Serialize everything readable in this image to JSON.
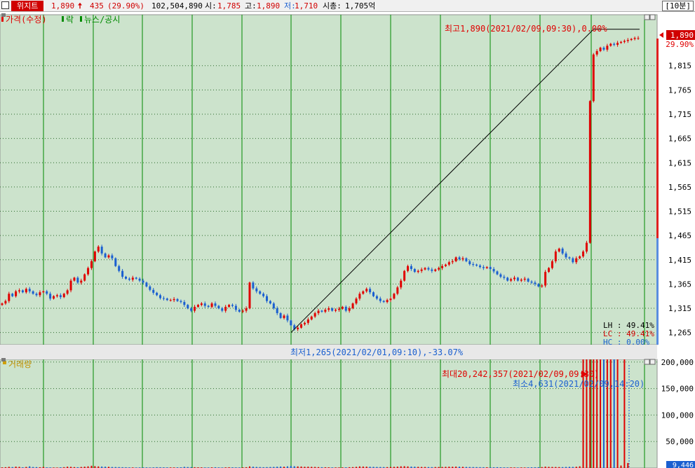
{
  "header": {
    "stock_name": "위지트",
    "price": "1,890",
    "change": "435",
    "change_pct": "(29.90%)",
    "volume": "102,504,890",
    "open_label": "시:",
    "open": "1,785",
    "high_label": "고:",
    "high": "1,890",
    "low_label": "저:",
    "low": "1,710",
    "mcap_label": "시총:",
    "mcap": "1,705억",
    "period": "[10분]"
  },
  "legend": {
    "price_panel": [
      "가격(수정)",
      "락",
      "뉴스/공시"
    ],
    "volume_panel": "거래량"
  },
  "annotations": {
    "max_price": "최고1,890(2021/02/09,09:30),0.00%",
    "min_price": "최저1,265(2021/02/01,09:10),-33.07%",
    "max_volume": "최대20,242,357(2021/02/09,09:30)",
    "min_volume": "최소4,631(2021/02/09,14:20)"
  },
  "stats": [
    {
      "label": "LH",
      "value": "49.41%",
      "color": "#000000"
    },
    {
      "label": "LC",
      "value": "49.41%",
      "color": "#d00000"
    },
    {
      "label": "HC",
      "value": "0.00%",
      "color": "#1a5fd0"
    }
  ],
  "current_price_label": {
    "price": "1,890",
    "pct": "29.90%"
  },
  "volume_last_label": "9,446",
  "colors": {
    "up": "#e00000",
    "down": "#1a5fd0",
    "bg": "#cce3cc",
    "gridline": "#008a00",
    "axis_text": "#000000"
  },
  "chart_data": [
    {
      "type": "candlestick",
      "title": "가격(수정)",
      "ylim": [
        1240,
        1920
      ],
      "yticks": [
        1265,
        1315,
        1365,
        1415,
        1465,
        1515,
        1565,
        1615,
        1665,
        1715,
        1765,
        1815
      ],
      "ytick_labels": [
        "1,265",
        "1,315",
        "1,365",
        "1,415",
        "1,465",
        "1,515",
        "1,565",
        "1,615",
        "1,665",
        "1,715",
        "1,765",
        "1,815"
      ],
      "close": [
        1325,
        1330,
        1345,
        1340,
        1350,
        1352,
        1348,
        1355,
        1350,
        1345,
        1342,
        1348,
        1350,
        1345,
        1335,
        1340,
        1342,
        1338,
        1345,
        1352,
        1372,
        1378,
        1368,
        1372,
        1385,
        1398,
        1412,
        1432,
        1442,
        1428,
        1420,
        1424,
        1418,
        1402,
        1392,
        1380,
        1376,
        1374,
        1378,
        1376,
        1372,
        1368,
        1360,
        1353,
        1347,
        1342,
        1336,
        1335,
        1332,
        1332,
        1334,
        1330,
        1328,
        1322,
        1315,
        1310,
        1318,
        1322,
        1325,
        1320,
        1318,
        1325,
        1320,
        1315,
        1310,
        1318,
        1322,
        1320,
        1312,
        1308,
        1310,
        1315,
        1368,
        1356,
        1350,
        1345,
        1340,
        1330,
        1325,
        1315,
        1305,
        1295,
        1300,
        1290,
        1280,
        1272,
        1275,
        1282,
        1285,
        1292,
        1298,
        1305,
        1310,
        1308,
        1312,
        1315,
        1310,
        1312,
        1314,
        1318,
        1310,
        1315,
        1325,
        1335,
        1345,
        1350,
        1355,
        1348,
        1340,
        1335,
        1330,
        1328,
        1332,
        1335,
        1345,
        1358,
        1372,
        1392,
        1402,
        1396,
        1390,
        1392,
        1395,
        1398,
        1395,
        1392,
        1395,
        1398,
        1402,
        1405,
        1410,
        1412,
        1420,
        1416,
        1418,
        1412,
        1406,
        1405,
        1403,
        1400,
        1398,
        1400,
        1396,
        1391,
        1385,
        1380,
        1378,
        1372,
        1375,
        1378,
        1372,
        1374,
        1376,
        1370,
        1368,
        1365,
        1360,
        1362,
        1390,
        1398,
        1412,
        1432,
        1438,
        1428,
        1420,
        1418,
        1410,
        1418,
        1422,
        1432,
        1450,
        1742,
        1838,
        1845,
        1852,
        1848,
        1856,
        1860,
        1858,
        1862,
        1864,
        1866,
        1868,
        1870,
        1872,
        1872
      ],
      "volume": [
        1200,
        1500,
        2200,
        1800,
        2600,
        2200,
        1400,
        2000,
        3200,
        1900,
        1700,
        1400,
        2100,
        1200,
        1100,
        1000,
        900,
        1300,
        1600,
        2500,
        2200,
        1700,
        1500,
        2000,
        2500,
        3100,
        4200,
        3500,
        3000,
        2800,
        2500,
        2200,
        1900,
        1800,
        1700,
        1500,
        1400,
        1200,
        1100,
        1000,
        1100,
        1200,
        1100,
        1000,
        1200,
        1500,
        1400,
        1300,
        1200,
        1100,
        1100,
        1200,
        1300,
        2200,
        1800,
        1600,
        1500,
        1300,
        1200,
        1100,
        1000,
        1200,
        1400,
        1100,
        1000,
        1200,
        1400,
        1300,
        1200,
        1100,
        1200,
        1500,
        3000,
        2500,
        2000,
        1800,
        1500,
        1700,
        1900,
        2100,
        2500,
        2800,
        2400,
        3200,
        3800,
        3400,
        3000,
        2800,
        2300,
        2500,
        2200,
        2000,
        1700,
        1500,
        1400,
        1300,
        1200,
        1100,
        1100,
        1200,
        1300,
        1500,
        1700,
        2200,
        3000,
        2800,
        2600,
        2400,
        2200,
        2000,
        1900,
        1800,
        1700,
        1900,
        2200,
        2600,
        3200,
        3400,
        3000,
        2700,
        2500,
        2200,
        2000,
        1900,
        1800,
        1700,
        1800,
        1900,
        2000,
        2200,
        2500,
        2400,
        2700,
        2500,
        2200,
        2000,
        1900,
        1800,
        1700,
        1600,
        1500,
        1400,
        1300,
        1400,
        1500,
        1300,
        1200,
        1100,
        1200,
        1100,
        1000,
        1100,
        1000,
        1200,
        1300,
        1400,
        1500,
        1800,
        2600,
        2200,
        2000,
        1900,
        1800,
        1700,
        2000,
        2200,
        2100,
        2400,
        3200,
        20242357,
        15000000,
        9500000,
        7000000,
        4800000,
        3600000,
        2600000,
        1800000,
        1500000,
        900000,
        400000,
        4631,
        300000,
        9446
      ]
    },
    {
      "type": "bar",
      "title": "거래량",
      "ylim": [
        0,
        205000
      ],
      "yticks": [
        50000,
        100000,
        150000,
        200000
      ],
      "ytick_labels": [
        "50,000",
        "100,000",
        "150,000",
        "200,000"
      ]
    }
  ]
}
